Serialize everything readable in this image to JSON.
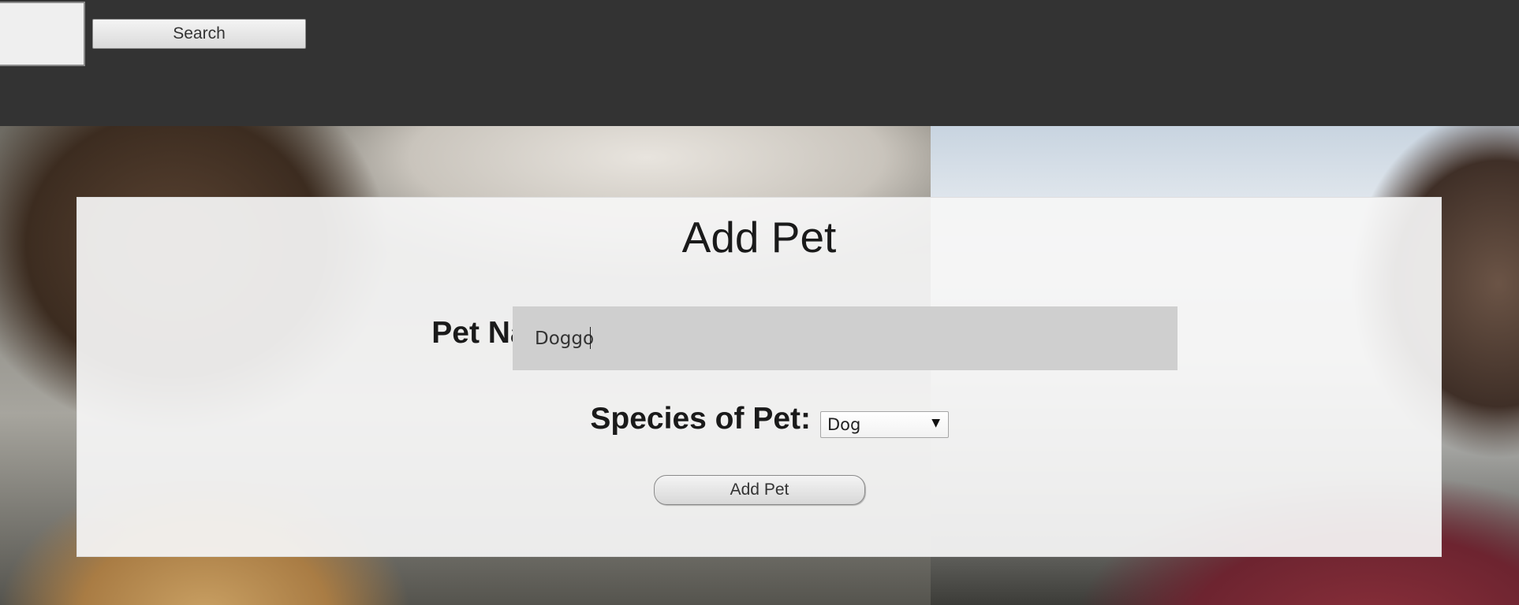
{
  "topbar": {
    "search_value": "",
    "search_button_label": "Search"
  },
  "form": {
    "title": "Add Pet",
    "pet_name_label": "Pet Name:",
    "pet_name_value": "Doggo",
    "species_label": "Species of Pet:",
    "species_selected": "Dog",
    "submit_label": "Add Pet"
  },
  "colors": {
    "topbar": "#333333",
    "panel": "#f5f5f5",
    "name_input_bg": "#cfcfcf"
  }
}
